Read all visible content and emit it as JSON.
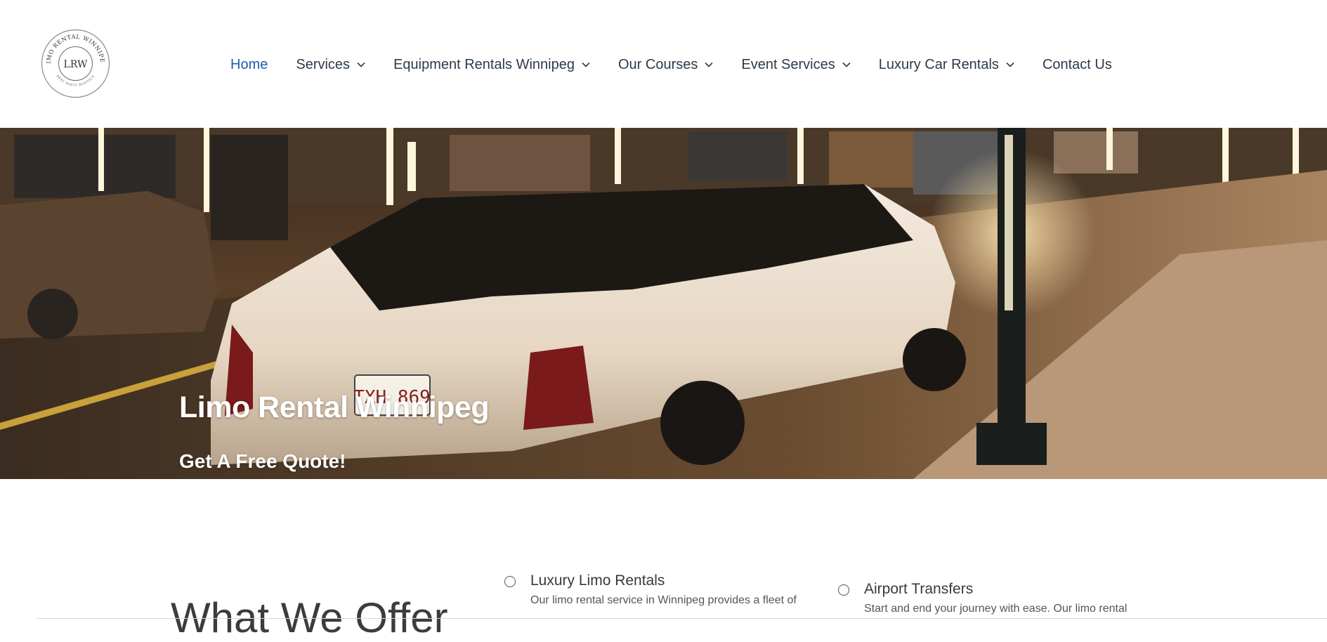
{
  "logo": {
    "ring_text_top": "LIMO RENTAL WINNIPEG",
    "monogram": "LRW",
    "ring_text_bottom": "BEST PARTY RENTALS"
  },
  "nav": {
    "items": [
      {
        "label": "Home",
        "active": true,
        "dropdown": false
      },
      {
        "label": "Services",
        "active": false,
        "dropdown": true
      },
      {
        "label": "Equipment Rentals Winnipeg",
        "active": false,
        "dropdown": true
      },
      {
        "label": "Our Courses",
        "active": false,
        "dropdown": true
      },
      {
        "label": "Event Services",
        "active": false,
        "dropdown": true
      },
      {
        "label": "Luxury Car Rentals",
        "active": false,
        "dropdown": true
      },
      {
        "label": "Contact Us",
        "active": false,
        "dropdown": false
      }
    ]
  },
  "hero": {
    "title": "Limo Rental Winnipeg",
    "subtitle": "Get A Free Quote!",
    "plate": "TXH 869"
  },
  "offer": {
    "heading": "What We Offer",
    "services": [
      {
        "title": "Luxury Limo Rentals",
        "desc": "Our limo rental service in Winnipeg provides a fleet of"
      },
      {
        "title": "Airport Transfers",
        "desc": "Start and end your journey with ease. Our limo rental"
      }
    ]
  },
  "colors": {
    "nav_active": "#1e5ea8",
    "nav_text": "#2c3a4a"
  }
}
